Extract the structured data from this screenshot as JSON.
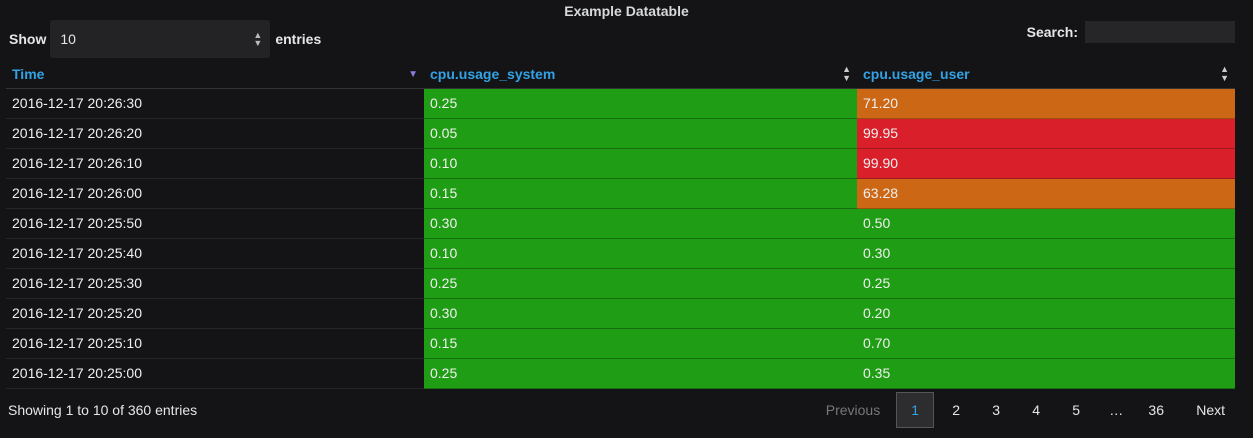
{
  "panel": {
    "title": "Example Datatable"
  },
  "length": {
    "show_label": "Show",
    "value": "10",
    "entries_label": "entries"
  },
  "search": {
    "label": "Search:",
    "value": ""
  },
  "table": {
    "columns": [
      "Time",
      "cpu.usage_system",
      "cpu.usage_user"
    ],
    "rows": [
      {
        "time": "2016-12-17 20:26:30",
        "system": "0.25",
        "user": "71.20",
        "system_status": "green",
        "user_status": "orange"
      },
      {
        "time": "2016-12-17 20:26:20",
        "system": "0.05",
        "user": "99.95",
        "system_status": "green",
        "user_status": "red"
      },
      {
        "time": "2016-12-17 20:26:10",
        "system": "0.10",
        "user": "99.90",
        "system_status": "green",
        "user_status": "red"
      },
      {
        "time": "2016-12-17 20:26:00",
        "system": "0.15",
        "user": "63.28",
        "system_status": "green",
        "user_status": "orange"
      },
      {
        "time": "2016-12-17 20:25:50",
        "system": "0.30",
        "user": "0.50",
        "system_status": "green",
        "user_status": "green"
      },
      {
        "time": "2016-12-17 20:25:40",
        "system": "0.10",
        "user": "0.30",
        "system_status": "green",
        "user_status": "green"
      },
      {
        "time": "2016-12-17 20:25:30",
        "system": "0.25",
        "user": "0.25",
        "system_status": "green",
        "user_status": "green"
      },
      {
        "time": "2016-12-17 20:25:20",
        "system": "0.30",
        "user": "0.20",
        "system_status": "green",
        "user_status": "green"
      },
      {
        "time": "2016-12-17 20:25:10",
        "system": "0.15",
        "user": "0.70",
        "system_status": "green",
        "user_status": "green"
      },
      {
        "time": "2016-12-17 20:25:00",
        "system": "0.25",
        "user": "0.35",
        "system_status": "green",
        "user_status": "green"
      }
    ]
  },
  "colors": {
    "green": "#1f9d14",
    "orange": "#cc6715",
    "red": "#d9202a",
    "header": "#33a2e5"
  },
  "footer": {
    "info": "Showing 1 to 10 of 360 entries",
    "pagination": {
      "previous": "Previous",
      "pages": [
        "1",
        "2",
        "3",
        "4",
        "5",
        "…",
        "36"
      ],
      "current": "1",
      "next": "Next"
    }
  }
}
